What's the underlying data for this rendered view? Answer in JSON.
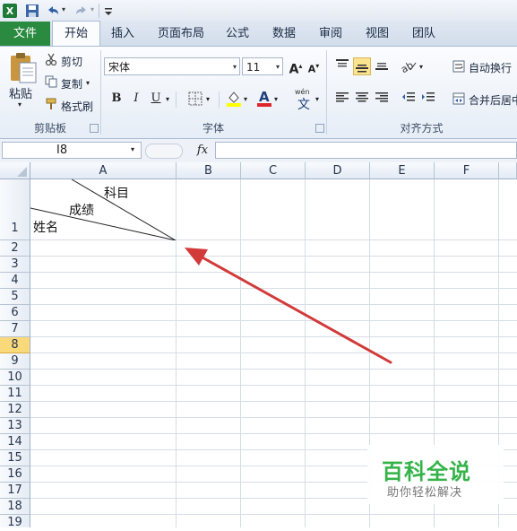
{
  "quick_access": {
    "icons": [
      "excel-logo-icon",
      "save-icon",
      "undo-icon",
      "redo-icon",
      "customize-qat-icon"
    ]
  },
  "tabs": [
    {
      "label": "文件"
    },
    {
      "label": "开始"
    },
    {
      "label": "插入"
    },
    {
      "label": "页面布局"
    },
    {
      "label": "公式"
    },
    {
      "label": "数据"
    },
    {
      "label": "审阅"
    },
    {
      "label": "视图"
    },
    {
      "label": "团队"
    }
  ],
  "clipboard": {
    "paste_label": "粘贴",
    "cut_label": "剪切",
    "copy_label": "复制",
    "format_painter_label": "格式刷",
    "group_label": "剪贴板"
  },
  "font": {
    "font_name": "宋体",
    "font_size": "11",
    "grow_label": "A",
    "shrink_label": "A",
    "bold": "B",
    "italic": "I",
    "underline": "U",
    "font_color_label": "A",
    "wen_label": "wén",
    "wen_char": "文",
    "group_label": "字体"
  },
  "alignment": {
    "wrap_label": "自动换行",
    "merge_label": "合并后居中",
    "group_label": "对齐方式"
  },
  "formula_bar": {
    "name_box": "I8",
    "fx_label": "fx",
    "formula": ""
  },
  "columns": [
    "A",
    "B",
    "C",
    "D",
    "E",
    "F"
  ],
  "rows": [
    "1",
    "2",
    "3",
    "4",
    "5",
    "6",
    "7",
    "8",
    "9",
    "10",
    "11",
    "12",
    "13",
    "14",
    "15",
    "16",
    "17",
    "18",
    "19"
  ],
  "active_row": "8",
  "cell_A1": {
    "subject": "科目",
    "score": "成绩",
    "name": "姓名"
  },
  "watermark": {
    "title": "百科全说",
    "subtitle": "助你轻松解决"
  },
  "colors": {
    "file_tab": "#2a8a3f",
    "arrow": "#d23a3a",
    "active_row_header": "#f9d97a"
  }
}
